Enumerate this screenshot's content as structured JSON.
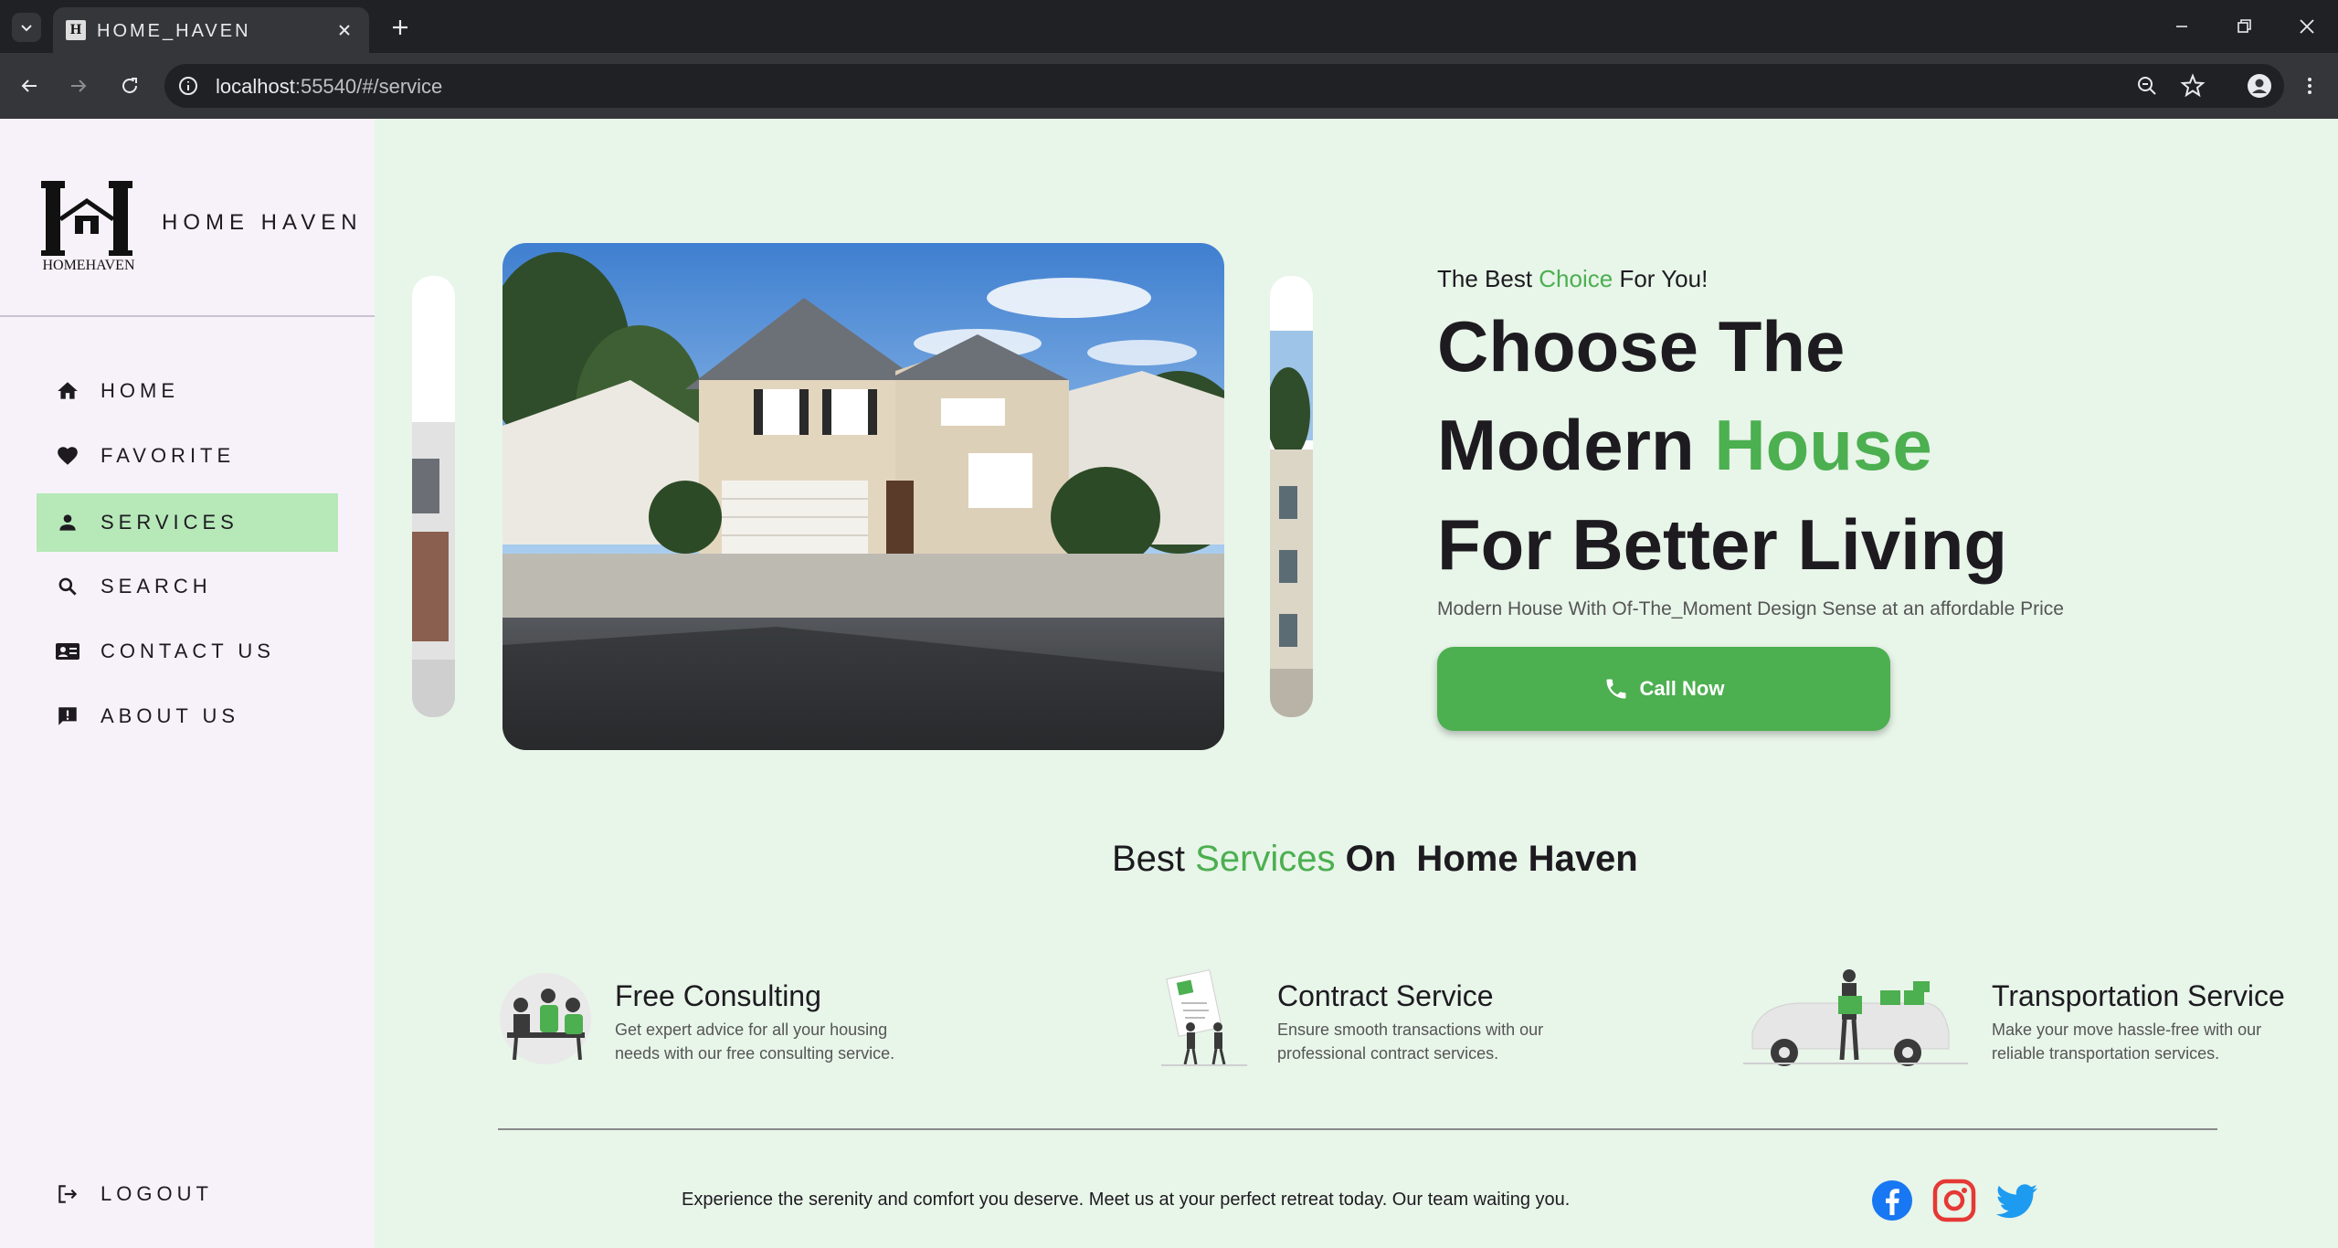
{
  "browser": {
    "tab_title": "HOME_HAVEN",
    "tab_favicon_letter": "H",
    "url_host": "localhost",
    "url_rest": ":55540/#/service"
  },
  "sidebar": {
    "brand": "HOME HAVEN",
    "logo_text": "HOMEHAVEN",
    "items": [
      {
        "label": "HOME",
        "icon": "home-icon"
      },
      {
        "label": "FAVORITE",
        "icon": "heart-icon"
      },
      {
        "label": "SERVICES",
        "icon": "person-icon",
        "active": true
      },
      {
        "label": "SEARCH",
        "icon": "search-icon"
      },
      {
        "label": "CONTACT US",
        "icon": "contact-card-icon"
      },
      {
        "label": "ABOUT US",
        "icon": "feedback-icon"
      }
    ],
    "logout": "LOGOUT"
  },
  "hero": {
    "tag_pre": "The Best ",
    "tag_accent": "Choice",
    "tag_post": " For You!",
    "line1": "Choose The",
    "line2_pre": "Modern ",
    "line2_accent": "House",
    "line3": "For Better Living",
    "subtitle": "Modern House With Of-The_Moment Design Sense at an affordable Price",
    "cta": "Call Now"
  },
  "services": {
    "title_pre": "Best ",
    "title_accent": "Services",
    "title_post": " On  Home Haven",
    "items": [
      {
        "title": "Free Consulting",
        "desc": "Get expert advice for all your housing needs with our free consulting service."
      },
      {
        "title": "Contract Service",
        "desc": "Ensure smooth transactions with our professional contract services."
      },
      {
        "title": "Transportation Service",
        "desc": "Make your move hassle-free with our reliable transportation services."
      }
    ]
  },
  "footer": {
    "text": "Experience the serenity and comfort you deserve. Meet us at your perfect retreat today. Our team waiting you.",
    "social": [
      "facebook-icon",
      "instagram-icon",
      "twitter-icon"
    ]
  },
  "colors": {
    "accent": "#4caf50",
    "page_bg": "#e8f5e9",
    "sidebar_bg": "#f7f2fa",
    "active_nav": "#b6e8b8"
  }
}
